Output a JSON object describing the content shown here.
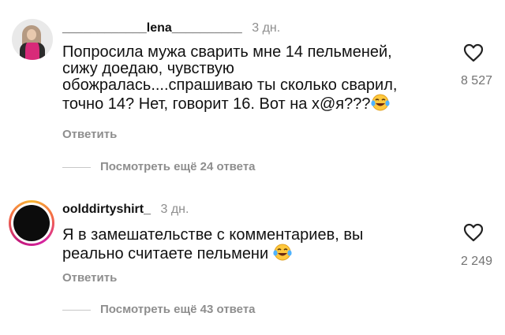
{
  "comments": [
    {
      "username": "____________lena__________",
      "time": "3 дн.",
      "lines": [
        "Попросила мужа сварить мне 14 пельменей,",
        "сижу доедаю, чувствую",
        "обожралась....спрашиваю ты сколько сварил,",
        "точно 14? Нет, говорит 16. Вот на х@я???"
      ],
      "reply_label": "Ответить",
      "likes": "8 527",
      "view_replies": "Посмотреть ещё 24 ответа"
    },
    {
      "username": "oolddirtyshirt_",
      "time": "3 дн.",
      "lines": [
        "Я в замешательстве с комментариев, вы",
        "реально считаете пельмени"
      ],
      "reply_label": "Ответить",
      "likes": "2 249",
      "view_replies": "Посмотреть ещё 43 ответа"
    }
  ],
  "icons": {
    "like": "heart-outline-icon",
    "emoji": "laughing-tears-emoji"
  },
  "colors": {
    "secondary_text": "#8e8e8e",
    "story_ring": "#d6249f"
  }
}
